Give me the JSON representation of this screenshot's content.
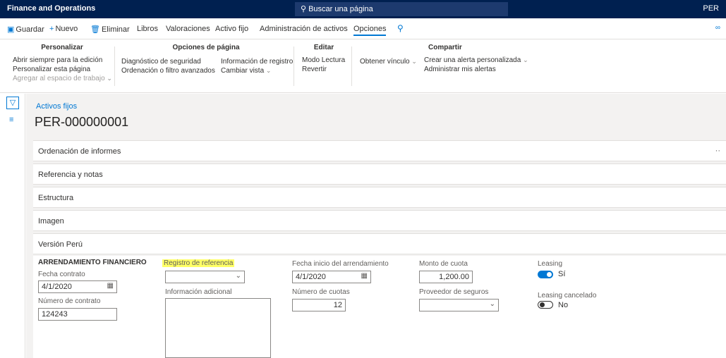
{
  "app": {
    "title": "Finance and Operations",
    "search_placeholder": "Buscar una página",
    "company": "PER"
  },
  "actions": {
    "save": "Guardar",
    "new": "Nuevo",
    "delete": "Eliminar",
    "tabs": [
      "Libros",
      "Valoraciones",
      "Activo fijo",
      "Administración de activos",
      "Opciones"
    ],
    "active_tab": "Opciones"
  },
  "ribbon": {
    "personalizar": {
      "title": "Personalizar",
      "items": [
        "Abrir siempre para la edición",
        "Personalizar esta página",
        "Agregar al espacio de trabajo"
      ]
    },
    "opciones_pagina": {
      "title": "Opciones de página",
      "col1": [
        "Diagnóstico de seguridad",
        "Ordenación o filtro avanzados"
      ],
      "col2": [
        "Información de registro",
        "Cambiar vista"
      ]
    },
    "editar": {
      "title": "Editar",
      "items": [
        "Modo Lectura",
        "Revertir"
      ]
    },
    "obtener": {
      "item": "Obtener vínculo"
    },
    "compartir": {
      "title": "Compartir",
      "items": [
        "Crear una alerta personalizada",
        "Administrar mis alertas"
      ]
    }
  },
  "header": {
    "breadcrumb": "Activos fijos",
    "record_id": "PER-000000001"
  },
  "fasttabs": [
    "Ordenación de informes",
    "Referencia y notas",
    "Estructura",
    "Imagen",
    "Versión Perú"
  ],
  "form": {
    "section_title": "ARRENDAMIENTO FINANCIERO",
    "fecha_contrato_label": "Fecha contrato",
    "fecha_contrato": "4/1/2020",
    "numero_contrato_label": "Número de contrato",
    "numero_contrato": "124243",
    "registro_referencia_label": "Registro de referencia",
    "registro_referencia": "",
    "info_adicional_label": "Información adicional",
    "fecha_inicio_label": "Fecha inicio del arrendamiento",
    "fecha_inicio": "4/1/2020",
    "numero_cuotas_label": "Número de cuotas",
    "numero_cuotas": "12",
    "monto_cuota_label": "Monto de cuota",
    "monto_cuota": "1,200.00",
    "proveedor_seguros_label": "Proveedor de seguros",
    "proveedor_seguros": "",
    "leasing_label": "Leasing",
    "leasing_value": "Sí",
    "leasing_cancelado_label": "Leasing cancelado",
    "leasing_cancelado_value": "No"
  }
}
